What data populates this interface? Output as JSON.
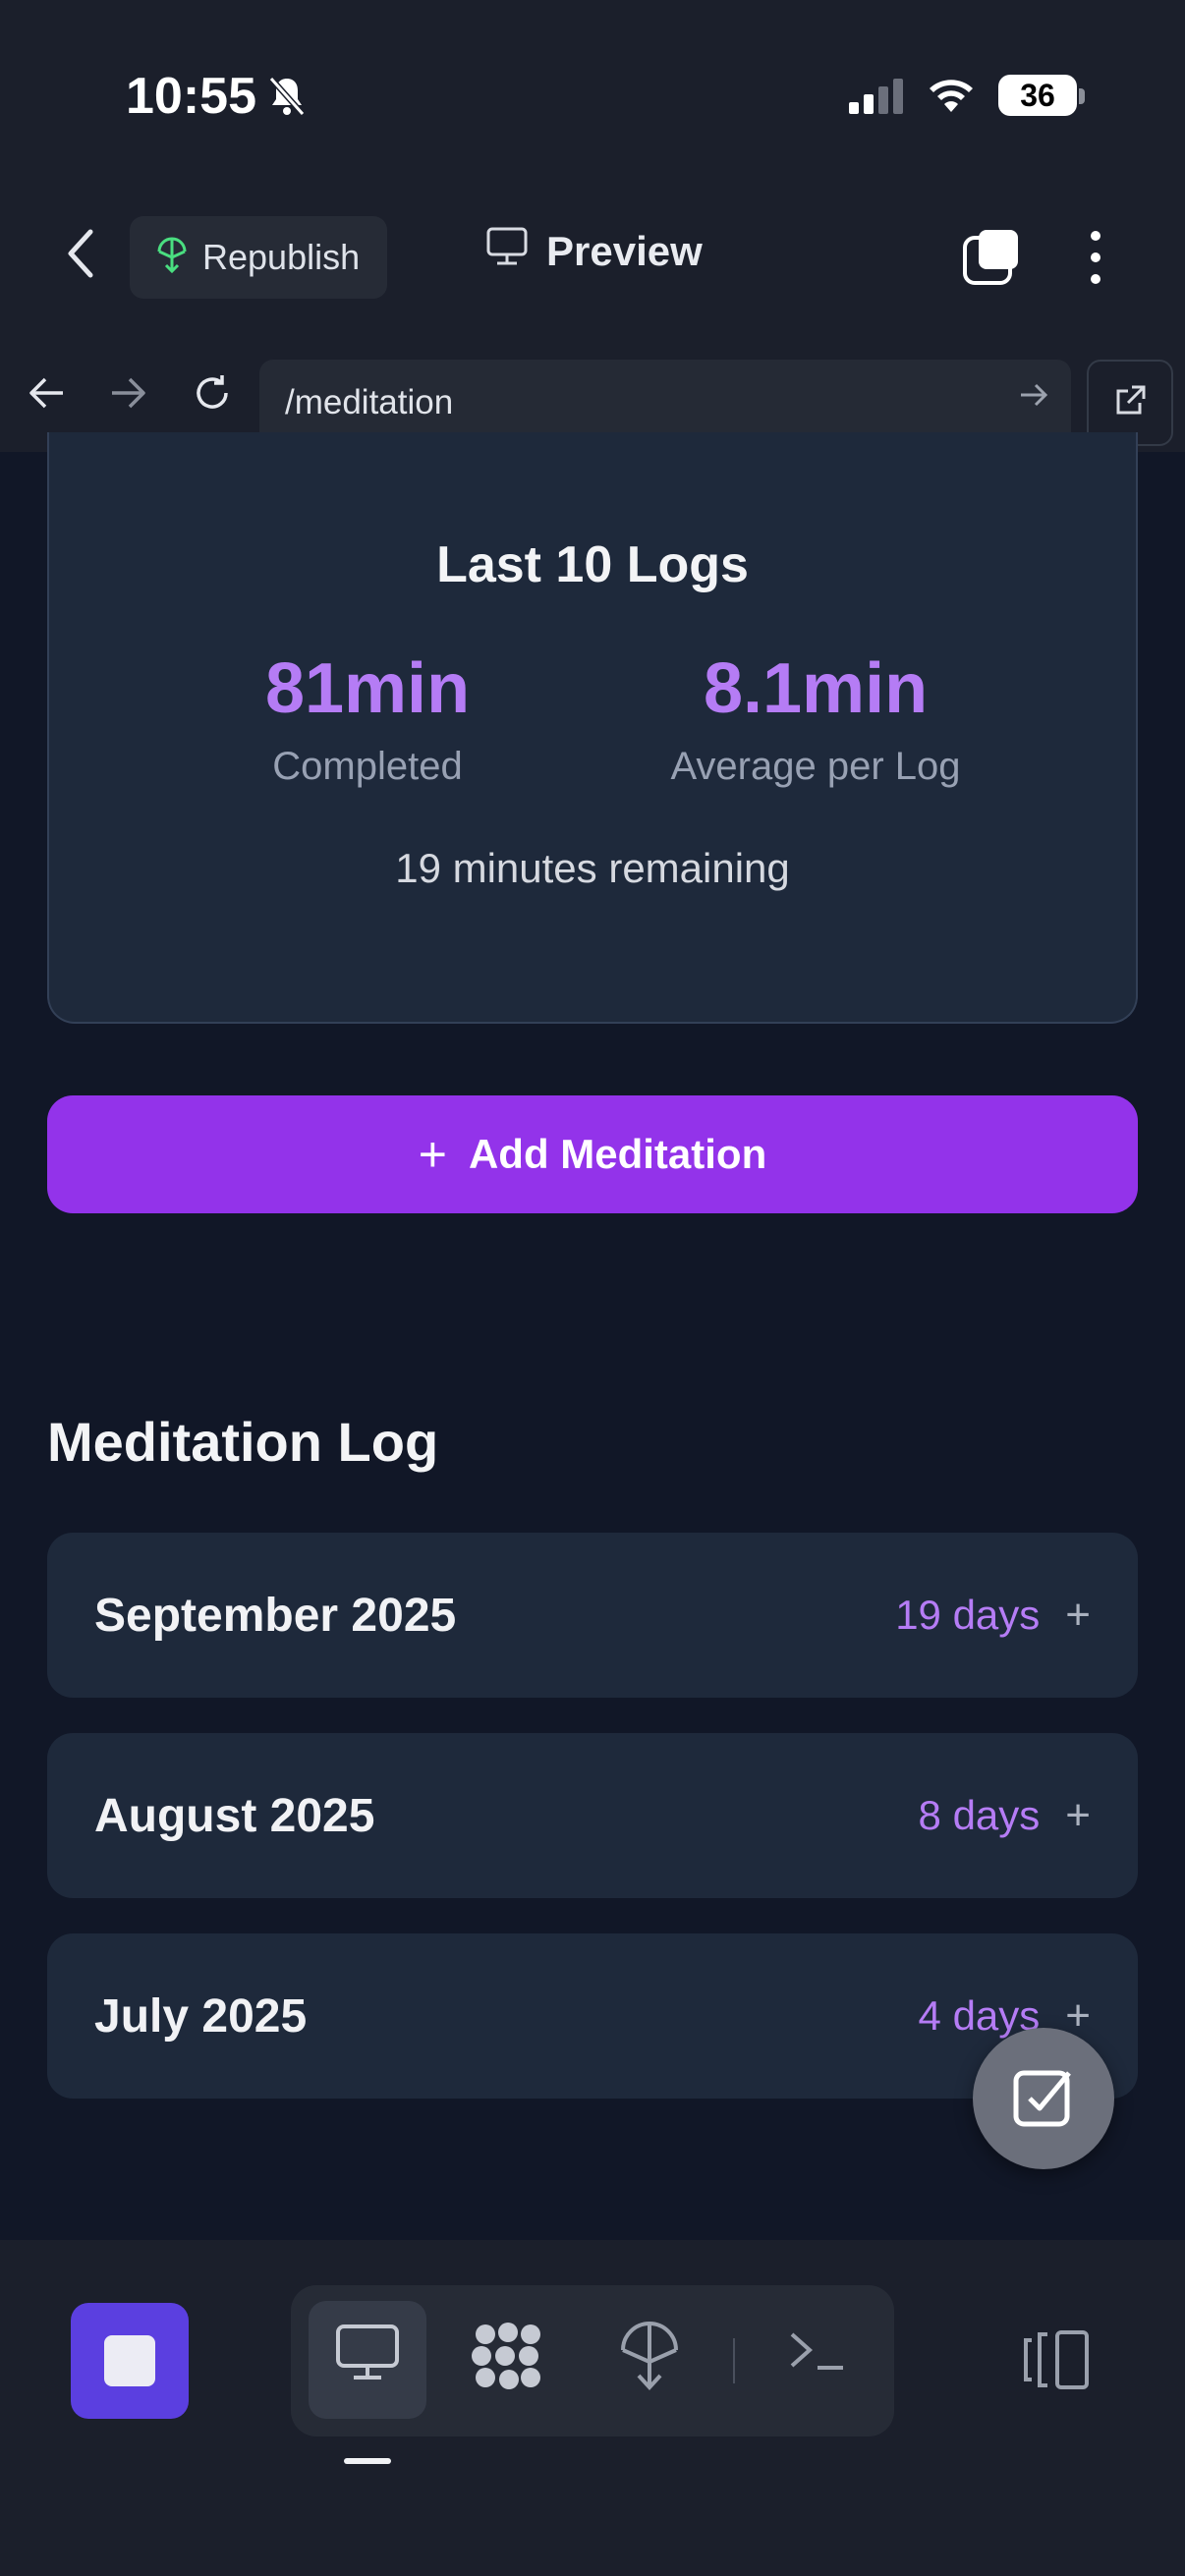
{
  "status_bar": {
    "time": "10:55",
    "battery": "36"
  },
  "header": {
    "republish_label": "Republish",
    "preview_label": "Preview"
  },
  "browser": {
    "url": "/meditation"
  },
  "summary_card": {
    "title": "Last 10 Logs",
    "completed_value": "81min",
    "completed_label": "Completed",
    "average_value": "8.1min",
    "average_label": "Average per Log",
    "remaining": "19 minutes remaining"
  },
  "add_button": {
    "icon": "+",
    "label": "Add Meditation"
  },
  "log": {
    "title": "Meditation Log",
    "months": [
      {
        "name": "September 2025",
        "days": "19 days",
        "expand": "+"
      },
      {
        "name": "August 2025",
        "days": "8 days",
        "expand": "+"
      },
      {
        "name": "July 2025",
        "days": "4 days",
        "expand": "+"
      }
    ]
  },
  "colors": {
    "accent": "#9333ea",
    "accent_text": "#b57cf5",
    "page_bg": "#111727",
    "card_bg": "#1e293b"
  }
}
